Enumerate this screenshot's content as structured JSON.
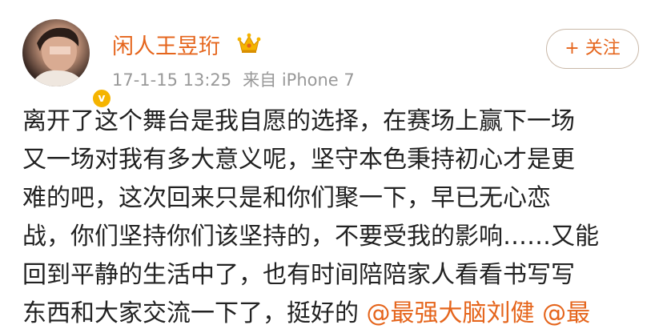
{
  "post": {
    "username": "闲人王昱珩",
    "timestamp": "17-1-15 13:25",
    "source": "来自 iPhone 7",
    "follow_label": "+ 关注",
    "verified_mark": "v",
    "crown_icon": "crown-icon",
    "body_lines": [
      "离开了这个舞台是我自愿的选择，在赛场上赢下一场",
      "又一场对我有多大意义呢，坚守本色秉持初心才是更",
      "难的吧，这次回来只是和你们聚一下，早已无心恋",
      "战，你们坚持你们该坚持的，不要受我的影响……又能",
      "回到平静的生活中了，也有时间陪陪家人看看书写写"
    ],
    "last_line_text": "东西和大家交流一下了，挺好的",
    "mentions": [
      "@最强大脑刘健",
      "@最"
    ]
  },
  "colors": {
    "accent": "#e5651c",
    "meta": "#999999",
    "text": "#222222",
    "verified": "#f5b400"
  }
}
